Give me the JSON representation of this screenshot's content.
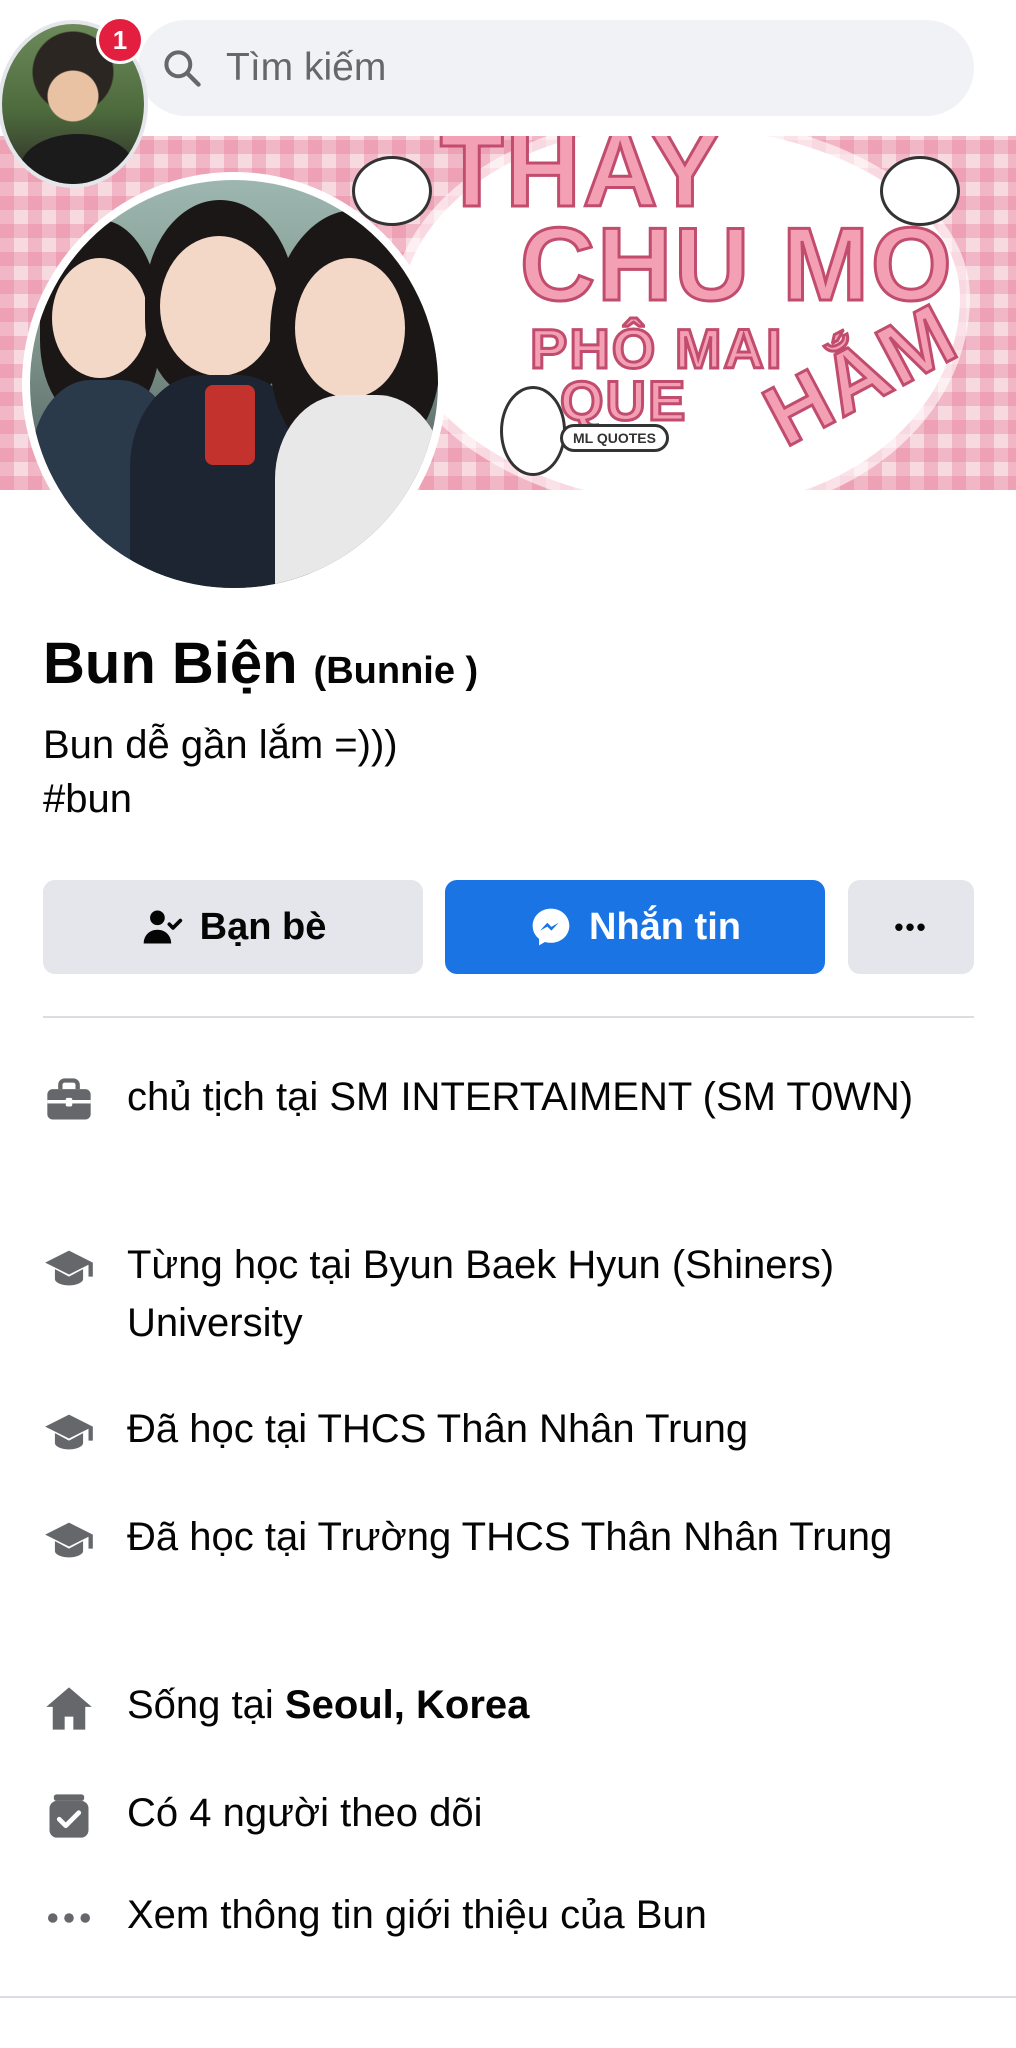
{
  "header": {
    "notification_count": "1",
    "search_placeholder": "Tìm kiếm"
  },
  "cover": {
    "lines": [
      "THAY",
      "CHU MO",
      "PHÔ MAI",
      "QUE",
      "HẮM"
    ],
    "tag": "ML QUOTES"
  },
  "profile": {
    "name": "Bun Biện",
    "nickname": "(Bunnie )",
    "bio_line1": "Bun dễ gần lắm =)))",
    "bio_line2": "#bun"
  },
  "actions": {
    "friends_label": "Bạn bè",
    "message_label": "Nhắn tin",
    "more_label": "•••"
  },
  "intro": {
    "work": "chủ tịch tại SM INTERTAIMENT (SM T0WN)",
    "education_1": "Từng học tại Byun Baek Hyun (Shiners) University",
    "education_2": "Đã học tại THCS Thân Nhân Trung",
    "education_3": "Đã học tại Trường THCS Thân Nhân Trung",
    "lives_prefix": "Sống tại ",
    "lives_place": "Seoul, Korea",
    "followers": "Có 4 người theo dõi",
    "see_more": "Xem thông tin giới thiệu của Bun"
  },
  "colors": {
    "accent": "#1b74e4",
    "badge": "#e41e3f",
    "button_gray": "#e4e6eb",
    "icon_gray": "#65676b"
  },
  "icons": [
    "search-icon",
    "friends-icon",
    "messenger-icon",
    "more-icon",
    "briefcase-icon",
    "graduation-cap-icon",
    "home-icon",
    "followers-icon",
    "dots-icon"
  ]
}
